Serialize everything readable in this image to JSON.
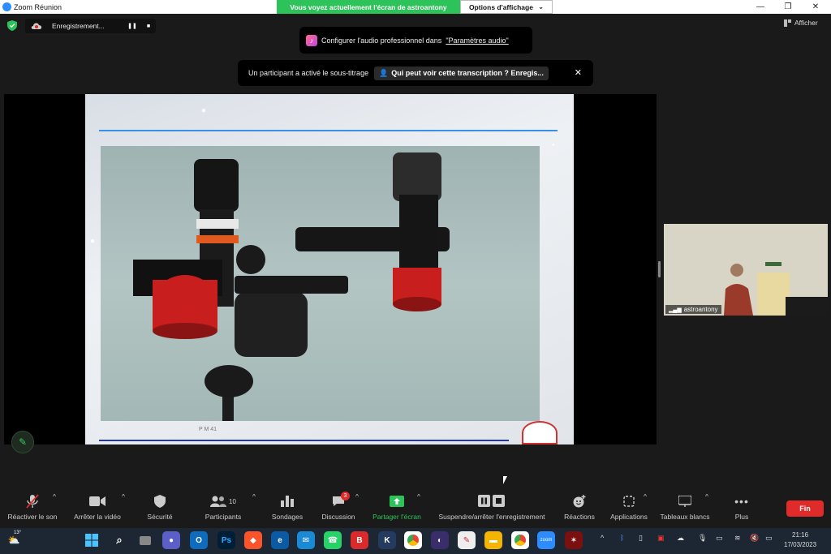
{
  "window": {
    "title": "Zoom Réunion",
    "share_banner": "Vous voyez actuellement l'écran de astroantony",
    "view_options_label": "Options d'affichage",
    "minimize": "—",
    "restore": "❐",
    "close": "✕"
  },
  "top_controls": {
    "recording_label": "Enregistrement...",
    "pause_glyph": "❚❚",
    "stop_glyph": "■",
    "show_label": "Afficher"
  },
  "notifications": {
    "audio_text": "Configurer l'audio professionnel dans",
    "audio_link": "\"Paramètres audio\"",
    "caption_text": "Un participant a activé le sous-titrage",
    "caption_button": "Qui peut voir cette transcription ? Enregis...",
    "close_glyph": "✕"
  },
  "shared_slide": {
    "footer_text": "P M 41"
  },
  "self_video": {
    "name": "astroantony"
  },
  "toolbar": {
    "items": [
      {
        "label": "Réactiver le son",
        "icon": "mic-muted-icon"
      },
      {
        "label": "Arrêter la vidéo",
        "icon": "video-camera-icon"
      },
      {
        "label": "Sécurité",
        "icon": "shield-icon"
      },
      {
        "label": "Participants",
        "icon": "participants-icon",
        "count": "10"
      },
      {
        "label": "Sondages",
        "icon": "poll-icon"
      },
      {
        "label": "Discussion",
        "icon": "chat-icon",
        "badge": "3"
      },
      {
        "label": "Partager l'écran",
        "icon": "share-screen-icon"
      },
      {
        "label": "Suspendre/arrêter l'enregistrement",
        "icon": "record-controls-icon"
      },
      {
        "label": "Réactions",
        "icon": "reactions-icon"
      },
      {
        "label": "Applications",
        "icon": "apps-icon"
      },
      {
        "label": "Tableaux blancs",
        "icon": "whiteboard-icon"
      },
      {
        "label": "Plus",
        "icon": "more-icon"
      }
    ],
    "end_label": "Fin"
  },
  "taskbar": {
    "weather_temp": "13°",
    "ps_label": "Ps",
    "b_label": "B",
    "zoom_label": "zoom",
    "time": "21:16",
    "date": "17/03/2023"
  },
  "colors": {
    "share_green": "#2ec35a",
    "end_red": "#e02b2b",
    "zoom_blue": "#2d8cff"
  }
}
